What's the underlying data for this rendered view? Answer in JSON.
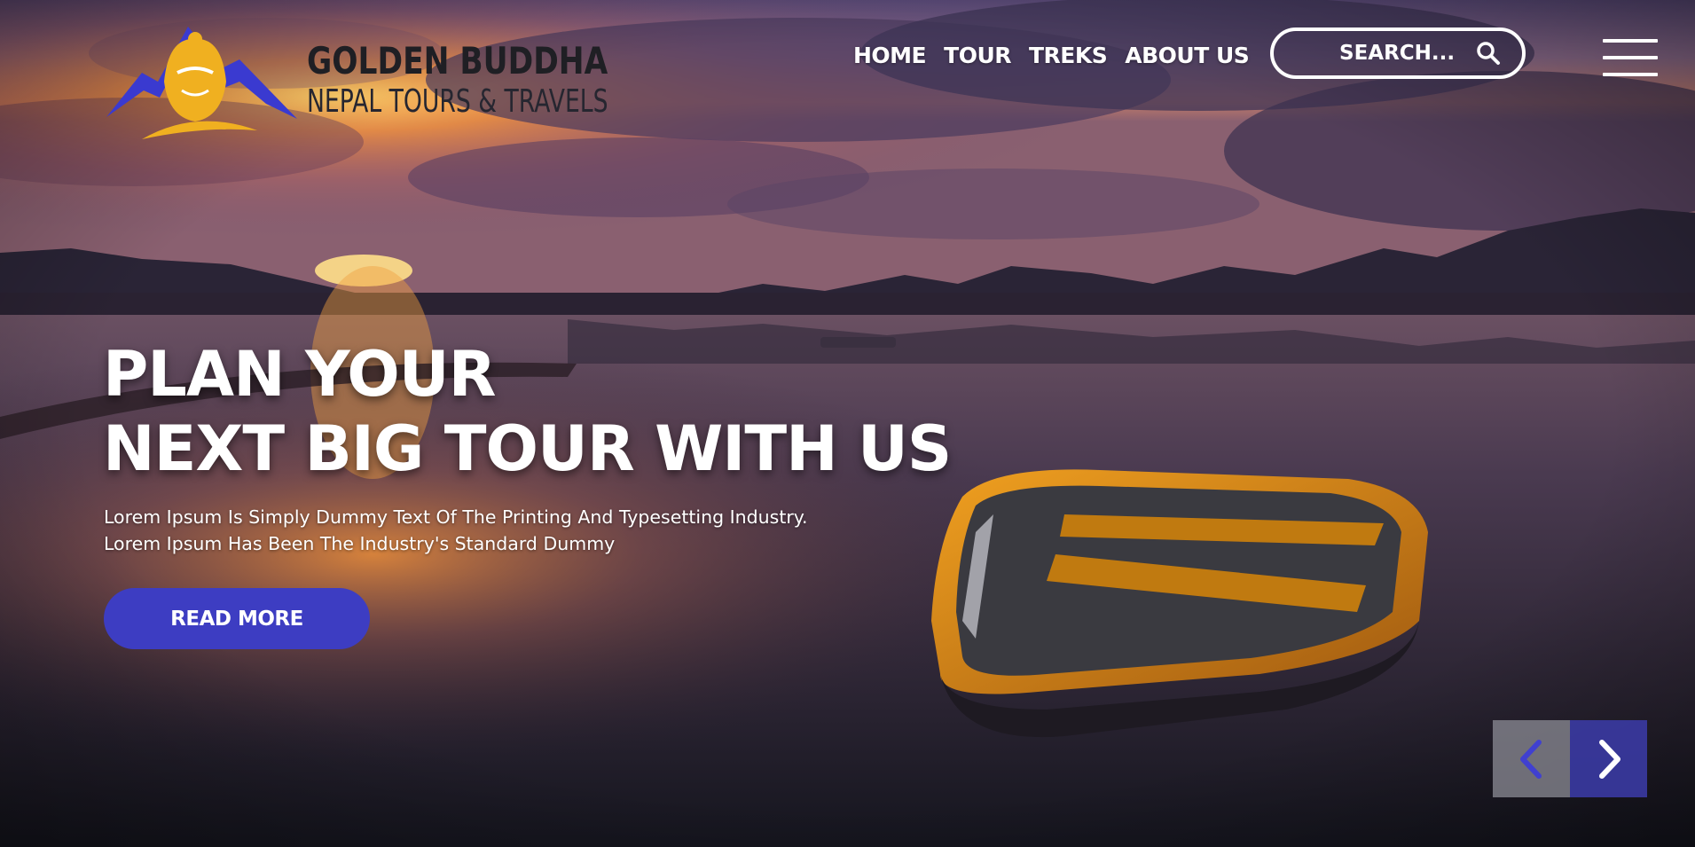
{
  "brand": {
    "name": "GOLDEN BUDDHA",
    "tagline": "NEPAL TOURS & TRAVELS"
  },
  "nav": {
    "items": [
      {
        "label": "HOME"
      },
      {
        "label": "TOUR"
      },
      {
        "label": "TREKS"
      },
      {
        "label": "ABOUT US"
      }
    ]
  },
  "search": {
    "placeholder": "SEARCH...",
    "icon": "search-icon"
  },
  "menu": {
    "icon": "hamburger-menu-icon"
  },
  "hero": {
    "headline_line1": "PLAN YOUR",
    "headline_line2": "NEXT BIG TOUR WITH US",
    "description_line1": "Lorem Ipsum Is Simply Dummy Text Of The Printing And Typesetting Industry.",
    "description_line2": "Lorem Ipsum Has Been The Industry's Standard Dummy",
    "cta_label": "READ MORE"
  },
  "slider": {
    "prev_icon": "chevron-left-icon",
    "next_icon": "chevron-right-icon"
  },
  "colors": {
    "accent": "#3d3dc2",
    "logo_mountain": "#3a3ad0",
    "logo_buddha": "#f0b020",
    "text_light": "#ffffff",
    "text_dark": "#1f1f24"
  }
}
